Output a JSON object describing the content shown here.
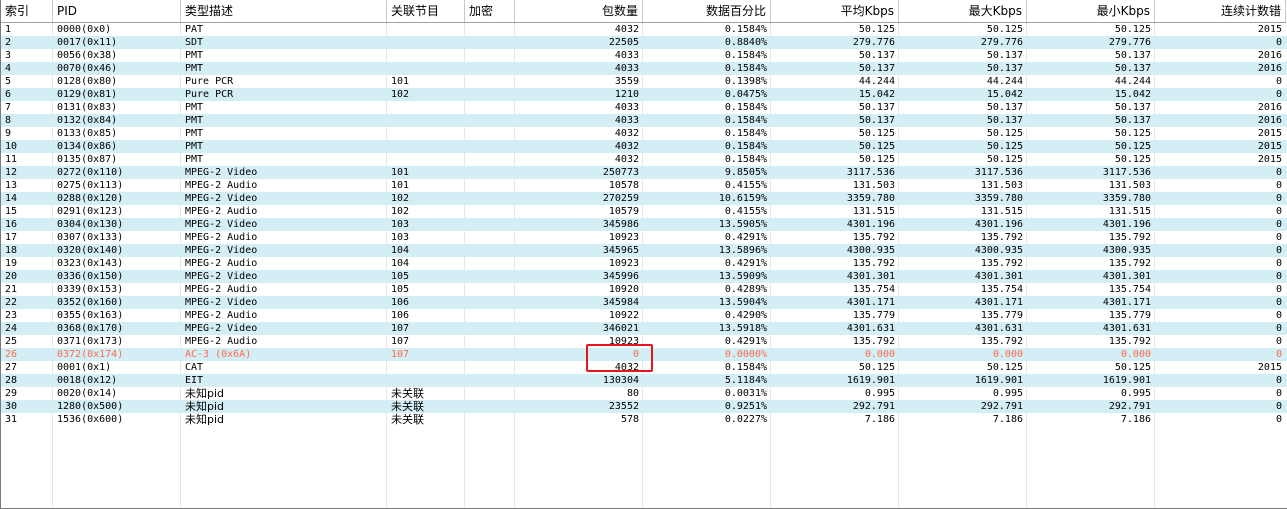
{
  "columns": [
    {
      "key": "idx",
      "label": "索引",
      "w": 52,
      "align": "l"
    },
    {
      "key": "pid",
      "label": "PID",
      "w": 128,
      "align": "l"
    },
    {
      "key": "type",
      "label": "类型描述",
      "w": 206,
      "align": "l"
    },
    {
      "key": "prog",
      "label": "关联节目",
      "w": 78,
      "align": "l"
    },
    {
      "key": "enc",
      "label": "加密",
      "w": 50,
      "align": "l"
    },
    {
      "key": "pkts",
      "label": "包数量",
      "w": 128,
      "align": "r"
    },
    {
      "key": "pct",
      "label": "数据百分比",
      "w": 128,
      "align": "r"
    },
    {
      "key": "avg",
      "label": "平均Kbps",
      "w": 128,
      "align": "r"
    },
    {
      "key": "max",
      "label": "最大Kbps",
      "w": 128,
      "align": "r"
    },
    {
      "key": "min",
      "label": "最小Kbps",
      "w": 128,
      "align": "r"
    },
    {
      "key": "cc",
      "label": "连续计数错",
      "w": 131,
      "align": "r"
    }
  ],
  "rows": [
    [
      "1",
      "0000(0x0)",
      "PAT",
      "",
      "",
      "4032",
      "0.1584%",
      "50.125",
      "50.125",
      "50.125",
      "2015"
    ],
    [
      "2",
      "0017(0x11)",
      "SDT",
      "",
      "",
      "22505",
      "0.8840%",
      "279.776",
      "279.776",
      "279.776",
      "0"
    ],
    [
      "3",
      "0056(0x38)",
      "PMT",
      "",
      "",
      "4033",
      "0.1584%",
      "50.137",
      "50.137",
      "50.137",
      "2016"
    ],
    [
      "4",
      "0070(0x46)",
      "PMT",
      "",
      "",
      "4033",
      "0.1584%",
      "50.137",
      "50.137",
      "50.137",
      "2016"
    ],
    [
      "5",
      "0128(0x80)",
      "Pure PCR",
      "101",
      "",
      "3559",
      "0.1398%",
      "44.244",
      "44.244",
      "44.244",
      "0"
    ],
    [
      "6",
      "0129(0x81)",
      "Pure PCR",
      "102",
      "",
      "1210",
      "0.0475%",
      "15.042",
      "15.042",
      "15.042",
      "0"
    ],
    [
      "7",
      "0131(0x83)",
      "PMT",
      "",
      "",
      "4033",
      "0.1584%",
      "50.137",
      "50.137",
      "50.137",
      "2016"
    ],
    [
      "8",
      "0132(0x84)",
      "PMT",
      "",
      "",
      "4033",
      "0.1584%",
      "50.137",
      "50.137",
      "50.137",
      "2016"
    ],
    [
      "9",
      "0133(0x85)",
      "PMT",
      "",
      "",
      "4032",
      "0.1584%",
      "50.125",
      "50.125",
      "50.125",
      "2015"
    ],
    [
      "10",
      "0134(0x86)",
      "PMT",
      "",
      "",
      "4032",
      "0.1584%",
      "50.125",
      "50.125",
      "50.125",
      "2015"
    ],
    [
      "11",
      "0135(0x87)",
      "PMT",
      "",
      "",
      "4032",
      "0.1584%",
      "50.125",
      "50.125",
      "50.125",
      "2015"
    ],
    [
      "12",
      "0272(0x110)",
      "MPEG-2 Video",
      "101",
      "",
      "250773",
      "9.8505%",
      "3117.536",
      "3117.536",
      "3117.536",
      "0"
    ],
    [
      "13",
      "0275(0x113)",
      "MPEG-2 Audio",
      "101",
      "",
      "10578",
      "0.4155%",
      "131.503",
      "131.503",
      "131.503",
      "0"
    ],
    [
      "14",
      "0288(0x120)",
      "MPEG-2 Video",
      "102",
      "",
      "270259",
      "10.6159%",
      "3359.780",
      "3359.780",
      "3359.780",
      "0"
    ],
    [
      "15",
      "0291(0x123)",
      "MPEG-2 Audio",
      "102",
      "",
      "10579",
      "0.4155%",
      "131.515",
      "131.515",
      "131.515",
      "0"
    ],
    [
      "16",
      "0304(0x130)",
      "MPEG-2 Video",
      "103",
      "",
      "345986",
      "13.5905%",
      "4301.196",
      "4301.196",
      "4301.196",
      "0"
    ],
    [
      "17",
      "0307(0x133)",
      "MPEG-2 Audio",
      "103",
      "",
      "10923",
      "0.4291%",
      "135.792",
      "135.792",
      "135.792",
      "0"
    ],
    [
      "18",
      "0320(0x140)",
      "MPEG-2 Video",
      "104",
      "",
      "345965",
      "13.5896%",
      "4300.935",
      "4300.935",
      "4300.935",
      "0"
    ],
    [
      "19",
      "0323(0x143)",
      "MPEG-2 Audio",
      "104",
      "",
      "10923",
      "0.4291%",
      "135.792",
      "135.792",
      "135.792",
      "0"
    ],
    [
      "20",
      "0336(0x150)",
      "MPEG-2 Video",
      "105",
      "",
      "345996",
      "13.5909%",
      "4301.301",
      "4301.301",
      "4301.301",
      "0"
    ],
    [
      "21",
      "0339(0x153)",
      "MPEG-2 Audio",
      "105",
      "",
      "10920",
      "0.4289%",
      "135.754",
      "135.754",
      "135.754",
      "0"
    ],
    [
      "22",
      "0352(0x160)",
      "MPEG-2 Video",
      "106",
      "",
      "345984",
      "13.5904%",
      "4301.171",
      "4301.171",
      "4301.171",
      "0"
    ],
    [
      "23",
      "0355(0x163)",
      "MPEG-2 Audio",
      "106",
      "",
      "10922",
      "0.4290%",
      "135.779",
      "135.779",
      "135.779",
      "0"
    ],
    [
      "24",
      "0368(0x170)",
      "MPEG-2 Video",
      "107",
      "",
      "346021",
      "13.5918%",
      "4301.631",
      "4301.631",
      "4301.631",
      "0"
    ],
    [
      "25",
      "0371(0x173)",
      "MPEG-2 Audio",
      "107",
      "",
      "10923",
      "0.4291%",
      "135.792",
      "135.792",
      "135.792",
      "0"
    ],
    [
      "26",
      "0372(0x174)",
      "AC-3 (0x6A)",
      "107",
      "",
      "0",
      "0.0000%",
      "0.000",
      "0.000",
      "0.000",
      "0"
    ],
    [
      "27",
      "0001(0x1)",
      "CAT",
      "",
      "",
      "4032",
      "0.1584%",
      "50.125",
      "50.125",
      "50.125",
      "2015"
    ],
    [
      "28",
      "0018(0x12)",
      "EIT",
      "",
      "",
      "130304",
      "5.1184%",
      "1619.901",
      "1619.901",
      "1619.901",
      "0"
    ],
    [
      "29",
      "0020(0x14)",
      "未知pid",
      "未关联",
      "",
      "80",
      "0.0031%",
      "0.995",
      "0.995",
      "0.995",
      "0"
    ],
    [
      "30",
      "1280(0x500)",
      "未知pid",
      "未关联",
      "",
      "23552",
      "0.9251%",
      "292.791",
      "292.791",
      "292.791",
      "0"
    ],
    [
      "31",
      "1536(0x600)",
      "未知pid",
      "未关联",
      "",
      "578",
      "0.0227%",
      "7.186",
      "7.186",
      "7.186",
      "0"
    ]
  ],
  "error_row_index": 25,
  "colors": {
    "alt_row": "#d3eef5",
    "error_text": "#ff6a4d",
    "highlight": "#e8141e"
  }
}
